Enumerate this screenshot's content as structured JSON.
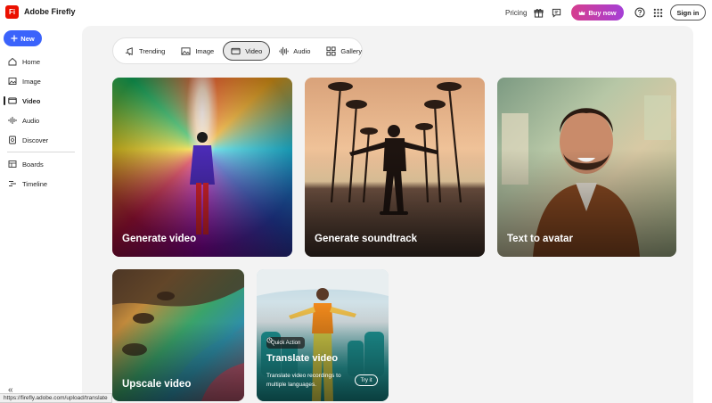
{
  "header": {
    "logo_text": "Fi",
    "app_name": "Adobe Firefly",
    "pricing_label": "Pricing",
    "buy_label": "Buy now",
    "signin_label": "Sign in",
    "accent_color": "#eb1000",
    "icons": [
      "gift-icon",
      "chat-icon",
      "help-icon",
      "apps-grid-icon"
    ]
  },
  "sidebar": {
    "new_label": "New",
    "items": [
      {
        "label": "Home",
        "icon": "home-icon"
      },
      {
        "label": "Image",
        "icon": "image-icon"
      },
      {
        "label": "Video",
        "icon": "video-icon",
        "active": true
      },
      {
        "label": "Audio",
        "icon": "audio-icon"
      },
      {
        "label": "Discover",
        "icon": "discover-icon"
      },
      {
        "label": "Boards",
        "icon": "boards-icon"
      },
      {
        "label": "Timeline",
        "icon": "timeline-icon"
      }
    ],
    "collapse_icon": "double-chevron-left-icon"
  },
  "tabs": [
    {
      "label": "Trending",
      "icon": "trending-icon"
    },
    {
      "label": "Image",
      "icon": "image-icon"
    },
    {
      "label": "Video",
      "icon": "video-icon",
      "active": true
    },
    {
      "label": "Audio",
      "icon": "audio-icon"
    },
    {
      "label": "Gallery",
      "icon": "gallery-icon"
    }
  ],
  "cards": [
    {
      "title": "Generate video"
    },
    {
      "title": "Generate soundtrack"
    },
    {
      "title": "Text to avatar"
    },
    {
      "title": "Upscale video"
    },
    {
      "badge": "Quick Action",
      "title": "Translate video",
      "description": "Translate video recordings to multiple languages.",
      "button": "Try it"
    }
  ],
  "status_url": "https://firefly.adobe.com/upload/translate"
}
